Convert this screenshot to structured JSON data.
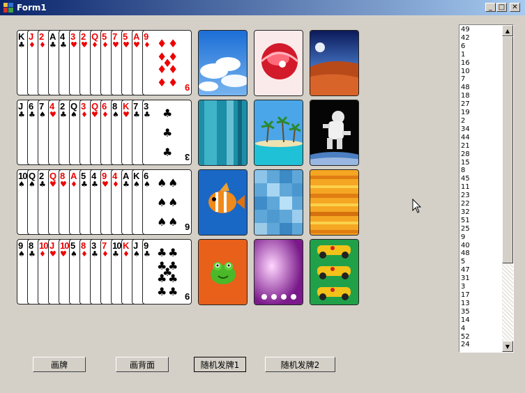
{
  "window": {
    "title": "Form1",
    "minimize_glyph": "_",
    "maximize_glyph": "□",
    "close_glyph": "✕"
  },
  "card_rows": [
    [
      "K♣",
      "J♦",
      "2♦",
      "A♣",
      "4♣",
      "3♥",
      "2♥",
      "Q♦",
      "5♦",
      "7♥",
      "5♥",
      "A♥",
      "9♦"
    ],
    [
      "J♣",
      "6♣",
      "7♠",
      "4♥",
      "2♣",
      "Q♠",
      "3♦",
      "Q♥",
      "6♦",
      "8♠",
      "K♥",
      "7♣",
      "3♣"
    ],
    [
      "10♠",
      "Q♠",
      "2♣",
      "Q♥",
      "8♥",
      "A♦",
      "5♣",
      "4♣",
      "9♥",
      "4♦",
      "A♣",
      "K♠",
      "6♠"
    ],
    [
      "9♠",
      "8♣",
      "10♦",
      "J♥",
      "10♥",
      "5♠",
      "8♦",
      "3♣",
      "7♦",
      "10♣",
      "K♦",
      "J♠",
      "9♣"
    ]
  ],
  "card_backs": [
    [
      "sky-back",
      "red-swirl-back",
      "desert-moon-back"
    ],
    [
      "teal-glass-back",
      "beach-palms-back",
      "astronaut-back"
    ],
    [
      "fish-back",
      "blue-tiles-back",
      "orange-stripes-back"
    ],
    [
      "frog-back",
      "purple-lights-back",
      "racecars-back"
    ]
  ],
  "buttons": {
    "draw_cards": "画牌",
    "draw_backs": "画背面",
    "deal_random_1": "随机发牌1",
    "deal_random_2": "随机发牌2"
  },
  "listbox": {
    "items": [
      "49",
      "42",
      "6",
      "1",
      "16",
      "10",
      "7",
      "48",
      "18",
      "27",
      "19",
      "2",
      "34",
      "44",
      "21",
      "28",
      "15",
      "8",
      "45",
      "11",
      "23",
      "22",
      "32",
      "51",
      "25",
      "9",
      "40",
      "48",
      "5",
      "47",
      "31",
      "3",
      "17",
      "13",
      "35",
      "14",
      "4",
      "52",
      "24"
    ]
  },
  "scrollbar": {
    "up_glyph": "▲",
    "down_glyph": "▼"
  },
  "colors": {
    "window_bg": "#d4d0c8",
    "titlebar_start": "#0a246a",
    "titlebar_end": "#a6caf0",
    "red_suit": "#e00000"
  }
}
